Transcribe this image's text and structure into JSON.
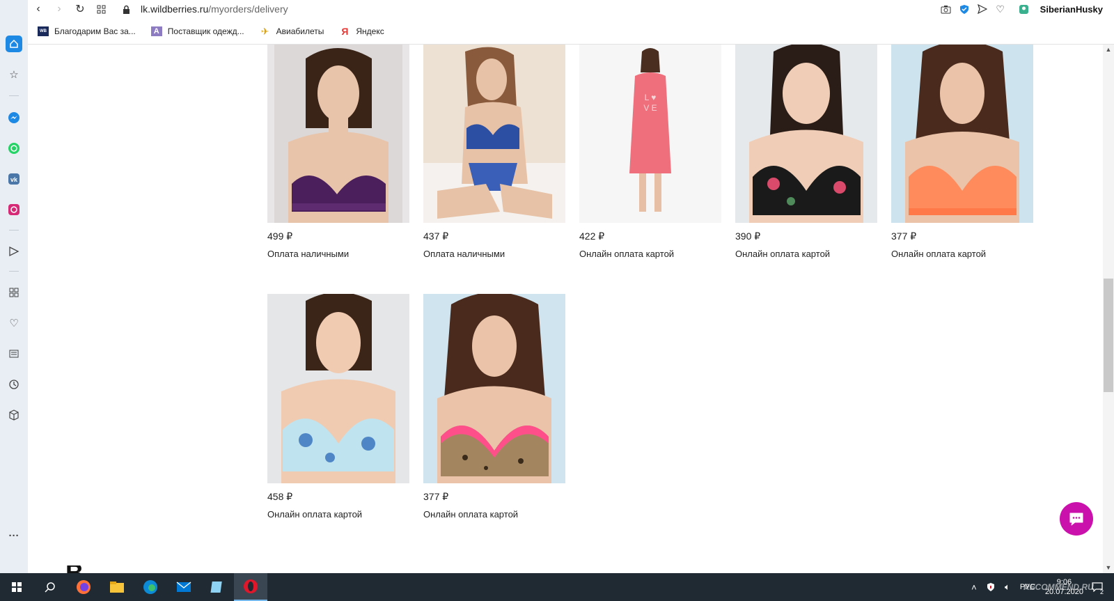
{
  "browser": {
    "url_domain": "lk.wildberries.ru",
    "url_path": "/myorders/delivery",
    "profile_name": "SiberianHusky"
  },
  "bookmarks": [
    {
      "label": "Благодарим Вас за...",
      "icon": "wildberries-icon"
    },
    {
      "label": "Поставщик одежд...",
      "icon": "letter-a-icon"
    },
    {
      "label": "Авиабилеты",
      "icon": "airplane-icon"
    },
    {
      "label": "Яндекс",
      "icon": "yandex-icon"
    }
  ],
  "products": [
    {
      "price": "499 ₽",
      "payment": "Оплата наличными",
      "image": "purple-bra"
    },
    {
      "price": "437 ₽",
      "payment": "Оплата наличными",
      "image": "blue-floral-lingerie-set"
    },
    {
      "price": "422 ₽",
      "payment": "Онлайн оплата картой",
      "image": "pink-love-nightdress"
    },
    {
      "price": "390 ₽",
      "payment": "Онлайн оплата картой",
      "image": "black-floral-bra"
    },
    {
      "price": "377 ₽",
      "payment": "Онлайн оплата картой",
      "image": "coral-lace-bra"
    },
    {
      "price": "458 ₽",
      "payment": "Онлайн оплата картой",
      "image": "light-blue-floral-bra"
    },
    {
      "price": "377 ₽",
      "payment": "Онлайн оплата картой",
      "image": "leopard-pink-bra"
    }
  ],
  "partial_heading": "В",
  "taskbar": {
    "time": "9:06",
    "date": "20.07.2020",
    "lang": "РУС",
    "notifications": "2"
  },
  "watermark": "RECOMMEND.RU",
  "colors": {
    "chat_button": "#cb11ab",
    "sidebar_bg": "#e9eef4",
    "taskbar_bg": "#1f2a33"
  }
}
